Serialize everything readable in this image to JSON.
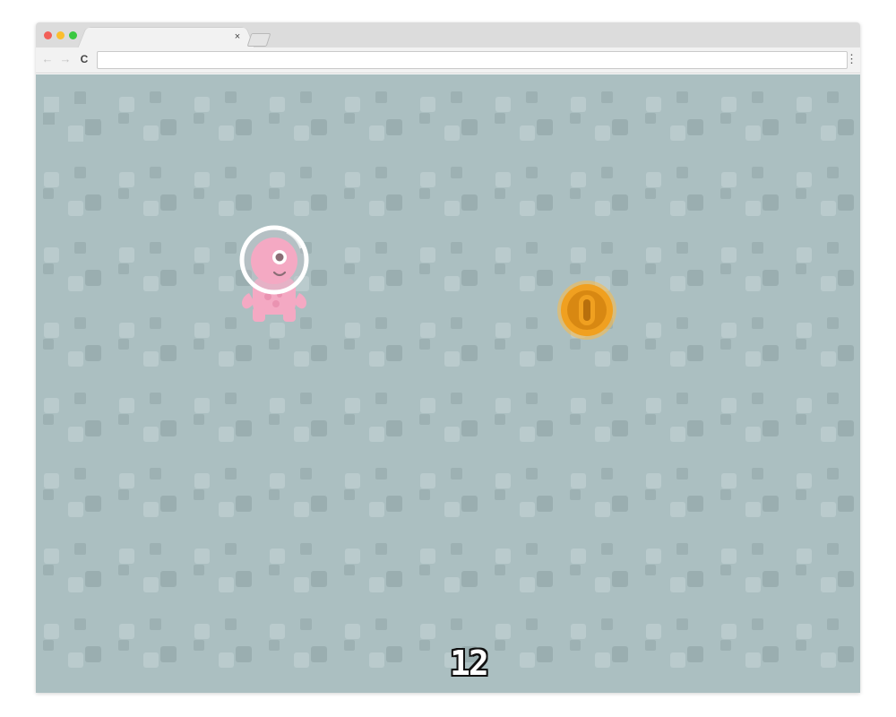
{
  "browser": {
    "tab_close_label": "×",
    "nav_back_glyph": "←",
    "nav_forward_glyph": "→",
    "reload_glyph": "C",
    "menu_glyph": "⋮",
    "address_value": "",
    "traffic_lights": [
      "#f25f58",
      "#fbbe2e",
      "#39c840"
    ]
  },
  "game": {
    "score": "12",
    "background_color": "#abbfc1",
    "player": {
      "icon": "pink-alien-astronaut-icon",
      "body_color": "#f4a9c3",
      "helmet_color": "#ffffff"
    },
    "coin": {
      "icon": "gold-coin-icon",
      "color": "#f0a020"
    }
  }
}
